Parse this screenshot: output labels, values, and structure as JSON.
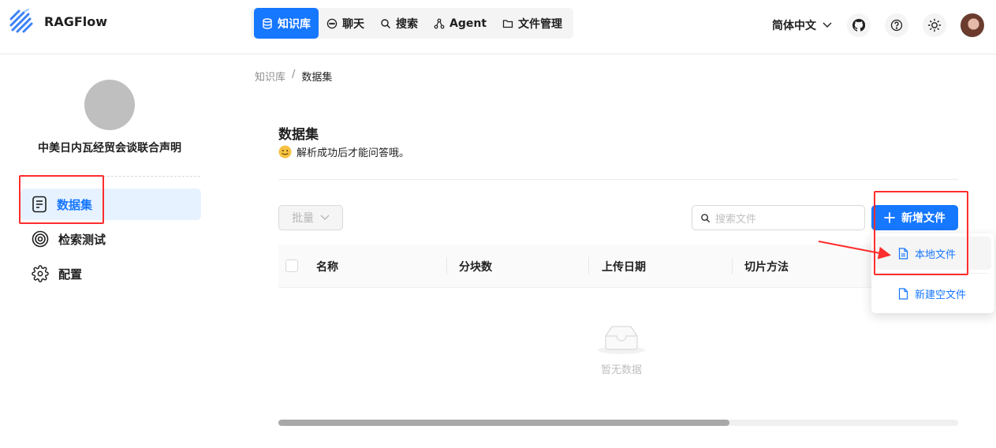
{
  "app": {
    "name": "RAGFlow"
  },
  "nav": [
    {
      "label": "知识库",
      "icon": "database-icon",
      "active": true
    },
    {
      "label": "聊天",
      "icon": "chat-icon",
      "active": false
    },
    {
      "label": "搜索",
      "icon": "search-icon",
      "active": false
    },
    {
      "label": "Agent",
      "icon": "agent-icon",
      "active": false
    },
    {
      "label": "文件管理",
      "icon": "folder-icon",
      "active": false
    }
  ],
  "header": {
    "language": "简体中文"
  },
  "sidebar": {
    "kb_name": "中美日内瓦经贸会谈联合声明",
    "items": [
      {
        "label": "数据集",
        "icon": "document-icon",
        "active": true
      },
      {
        "label": "检索测试",
        "icon": "target-icon",
        "active": false
      },
      {
        "label": "配置",
        "icon": "gear-icon",
        "active": false
      }
    ]
  },
  "breadcrumb": {
    "root": "知识库",
    "sep": "/",
    "current": "数据集"
  },
  "main": {
    "title": "数据集",
    "subtitle": "解析成功后才能问答哦。",
    "bulk_label": "批量",
    "search_placeholder": "搜索文件",
    "new_file_label": "新增文件",
    "columns": [
      "名称",
      "分块数",
      "上传日期",
      "切片方法"
    ],
    "empty_text": "暂无数据"
  },
  "dropdown": {
    "local_file": "本地文件",
    "empty_file": "新建空文件"
  },
  "colors": {
    "accent": "#1677ff",
    "highlight_box": "#ff2d2d"
  }
}
